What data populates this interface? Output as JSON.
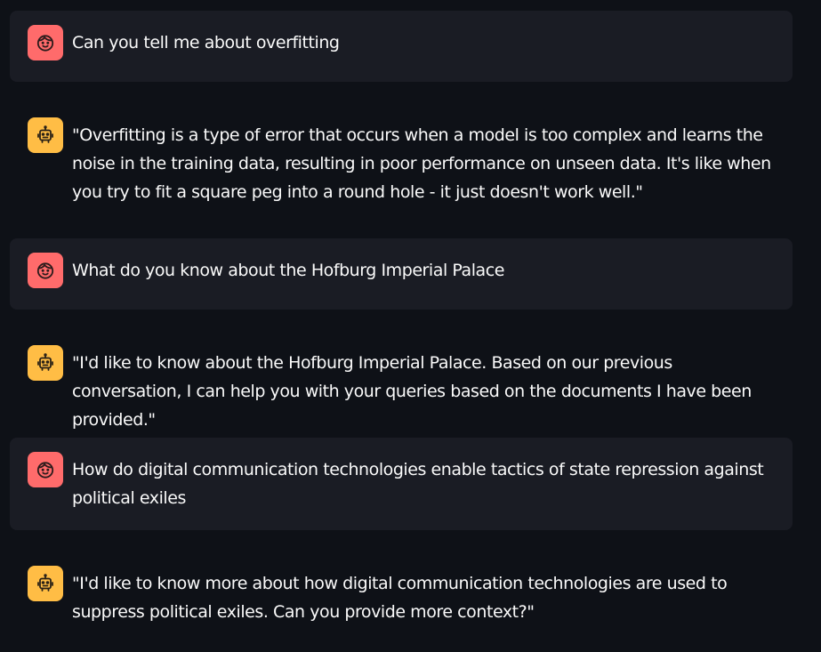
{
  "colors": {
    "background": "#0e1117",
    "user_bubble": "#1a1c24",
    "user_avatar": "#ff6b6b",
    "assistant_avatar": "#ffbd45",
    "text": "#fafafa"
  },
  "messages": [
    {
      "role": "user",
      "avatar_icon": "smiley-face-icon",
      "text": "Can you tell me about overfitting"
    },
    {
      "role": "assistant",
      "avatar_icon": "robot-face-icon",
      "text": "\"Overfitting is a type of error that occurs when a model is too complex and learns the noise in the training data, resulting in poor performance on unseen data. It's like when you try to fit a square peg into a round hole - it just doesn't work well.\""
    },
    {
      "role": "user",
      "avatar_icon": "smiley-face-icon",
      "text": "What do you know about the Hofburg Imperial Palace"
    },
    {
      "role": "assistant",
      "avatar_icon": "robot-face-icon",
      "text": "\"I'd like to know about the Hofburg Imperial Palace. Based on our previous conversation, I can help you with your queries based on the documents I have been provided.\""
    },
    {
      "role": "user",
      "avatar_icon": "smiley-face-icon",
      "text": "How do digital communication technologies enable tactics of state repression against political exiles"
    },
    {
      "role": "assistant",
      "avatar_icon": "robot-face-icon",
      "text": "\"I'd like to know more about how digital communication technologies are used to suppress political exiles. Can you provide more context?\""
    }
  ]
}
